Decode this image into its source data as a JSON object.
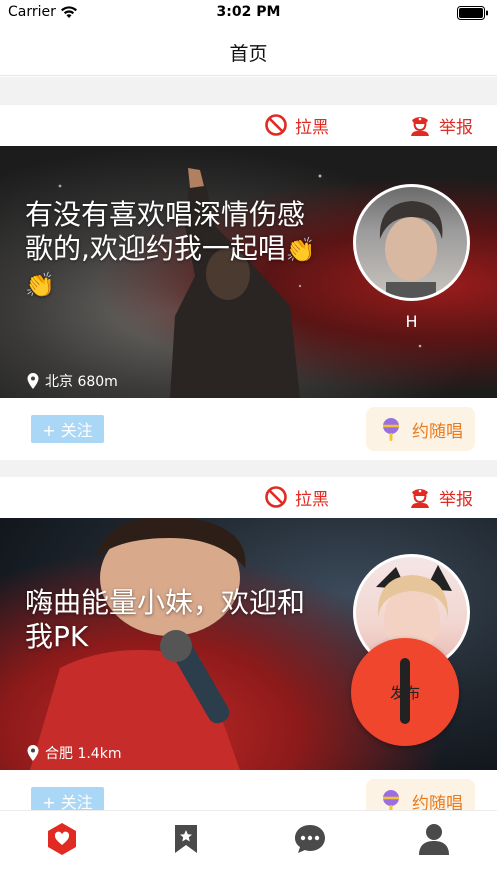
{
  "status_bar": {
    "carrier": "Carrier",
    "time": "3:02 PM"
  },
  "header": {
    "title": "首页"
  },
  "cards": [
    {
      "block_label": "拉黑",
      "report_label": "举报",
      "caption": "有没有喜欢唱深情伤感歌的,欢迎约我一起唱",
      "caption_emoji": "👏👏",
      "avatar_name": "H",
      "location": "北京 680m",
      "follow_label": "+ 关注",
      "sing_label": "约随唱"
    },
    {
      "block_label": "拉黑",
      "report_label": "举报",
      "caption": "嗨曲能量小妹，欢迎和我PK",
      "caption_emoji": "",
      "avatar_name": "",
      "location": "合肥 1.4km",
      "follow_label": "+ 关注",
      "sing_label": "约随唱"
    }
  ],
  "fab": {
    "label": "发布"
  },
  "tabs": [
    {
      "icon": "heart-hexagon-icon",
      "active": true
    },
    {
      "icon": "bookmark-star-icon",
      "active": false
    },
    {
      "icon": "chat-bubble-icon",
      "active": false
    },
    {
      "icon": "person-icon",
      "active": false
    }
  ],
  "colors": {
    "accent": "#e02a22",
    "fab": "#f0462e",
    "follow": "#a9d7f5",
    "sing_text": "#e87b1e",
    "sing_bg": "#fdf3e5",
    "tab_inactive": "#4a4a4a"
  }
}
